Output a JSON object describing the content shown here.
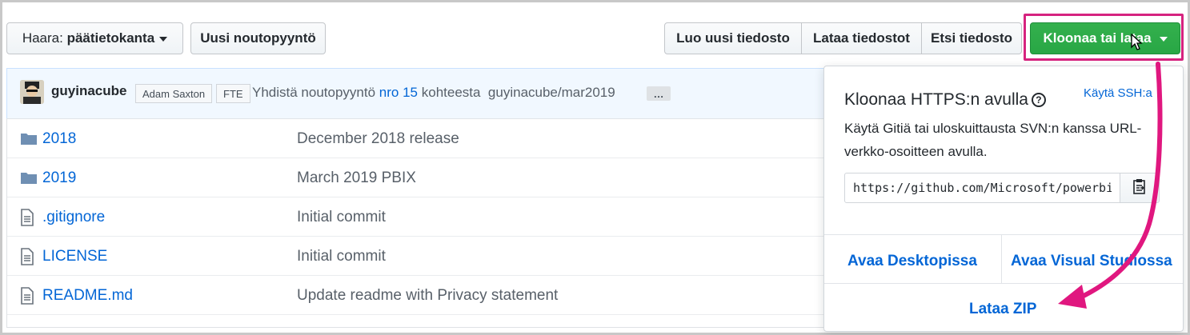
{
  "toolbar": {
    "branch_prefix": "Haara:",
    "branch_name": "päätietokanta",
    "new_pull_request": "Uusi noutopyyntö",
    "create_file": "Luo uusi tiedosto",
    "upload_files": "Lataa tiedostot",
    "find_file": "Etsi tiedosto",
    "clone_or_download": "Kloonaa tai lataa"
  },
  "commit": {
    "user": "guyinacube",
    "tags": [
      "Adam Saxton",
      "FTE"
    ],
    "message_prefix": "Yhdistä noutopyyntö",
    "pr_link": "nro 15",
    "message_middle": "kohteesta",
    "branch_ref": "guyinacube/mar2019",
    "more": "…"
  },
  "files": [
    {
      "type": "folder",
      "name": "2018",
      "message": "December 2018 release"
    },
    {
      "type": "folder",
      "name": "2019",
      "message": "March 2019 PBIX"
    },
    {
      "type": "file",
      "name": ".gitignore",
      "message": "Initial commit"
    },
    {
      "type": "file",
      "name": "LICENSE",
      "message": "Initial commit"
    },
    {
      "type": "file",
      "name": "README.md",
      "message": "Update readme with Privacy statement"
    }
  ],
  "clone_panel": {
    "title": "Kloonaa HTTPS:n avulla",
    "help_icon": "?",
    "use_ssh": "Käytä SSH:a",
    "description": "Käytä Gitiä tai uloskuittausta SVN:n kanssa URL-verkko-osoitteen avulla.",
    "url": "https://github.com/Microsoft/powerbi-desktop-samples.git",
    "open_desktop": "Avaa Desktopissa",
    "open_visual_studio": "Avaa Visual Studiossa",
    "download_zip": "Lataa ZIP"
  },
  "colors": {
    "accent_green": "#28a745",
    "link_blue": "#0366d6",
    "highlight_magenta": "#e0177f"
  }
}
